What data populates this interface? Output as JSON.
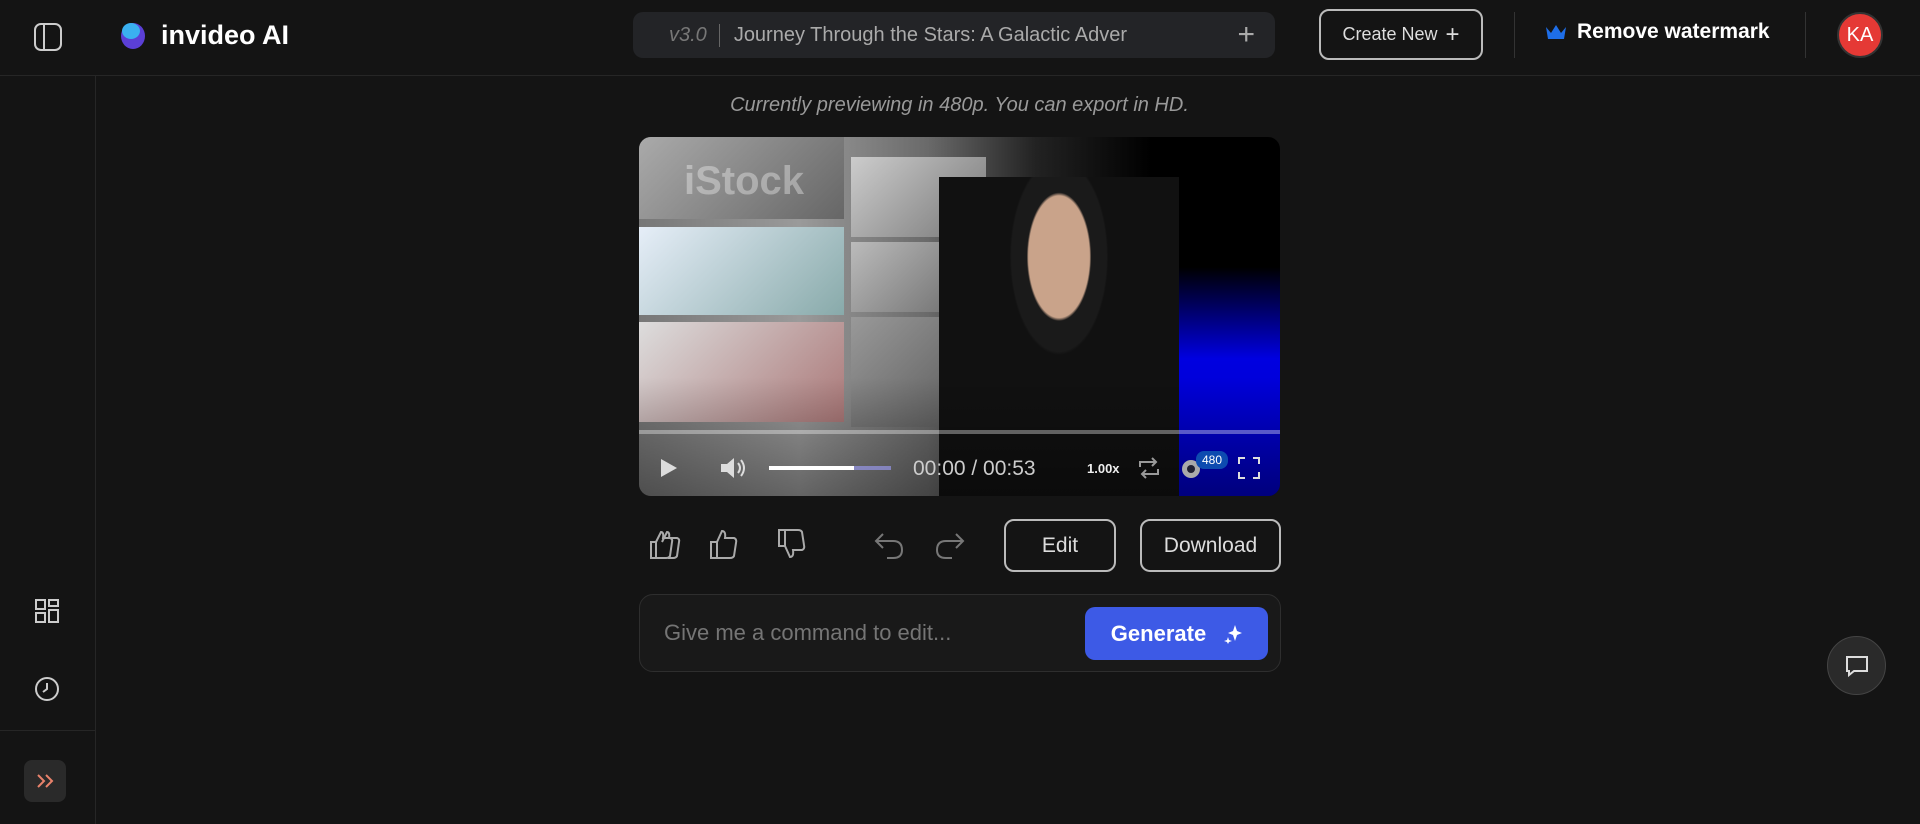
{
  "header": {
    "logo": "invideo AI",
    "version": "v3.0",
    "project_title": "Journey Through the Stars: A Galactic Adver",
    "create_new": "Create New",
    "remove_watermark": "Remove watermark",
    "avatar_initials": "KA"
  },
  "preview_note": "Currently previewing in 480p. You can export in HD.",
  "player": {
    "watermark": "iStock",
    "time": "00:00 / 00:53",
    "speed": "1.00x",
    "quality": "480",
    "volume": 0.7,
    "progress": 0
  },
  "actions": {
    "edit": "Edit",
    "download": "Download"
  },
  "command": {
    "placeholder": "Give me a command to edit...",
    "generate": "Generate"
  },
  "colors": {
    "accent": "#3d5ae6",
    "avatar": "#e53935",
    "watermark_icon": "#1e6ee8"
  }
}
